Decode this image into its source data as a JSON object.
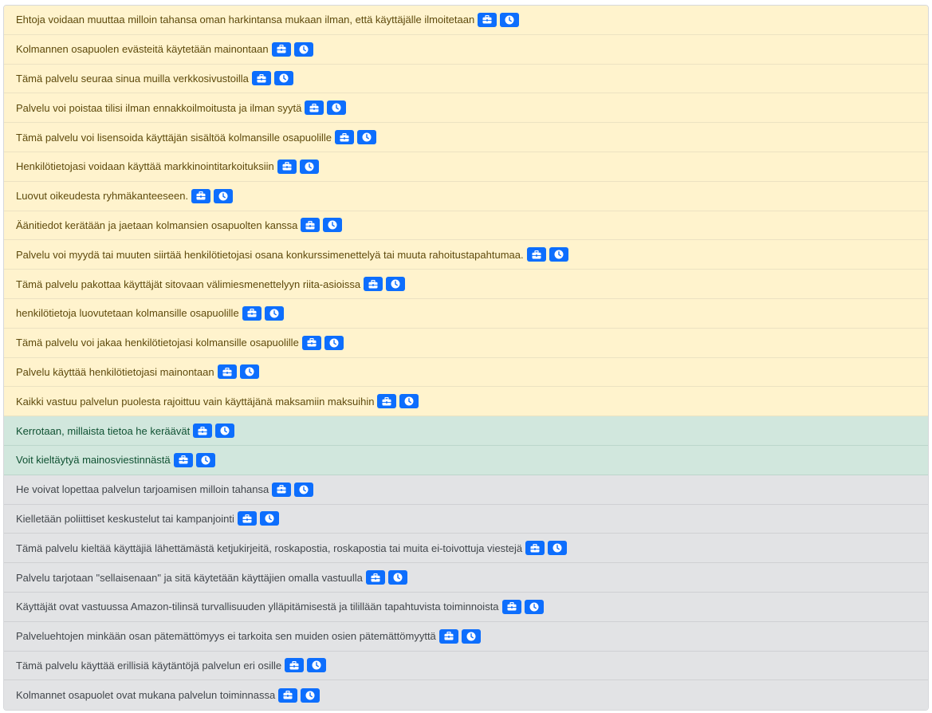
{
  "colors": {
    "bad_bg": "#fff3cd",
    "good_bg": "#d1e7dd",
    "neutral_bg": "#e2e3e5",
    "button_blue": "#0d6efd"
  },
  "icons": {
    "first_button": "briefcase-icon",
    "second_button": "clock-icon"
  },
  "items": [
    {
      "text": "Ehtoja voidaan muuttaa milloin tahansa oman harkintansa mukaan ilman, että käyttäjälle ilmoitetaan",
      "tone": "bad"
    },
    {
      "text": "Kolmannen osapuolen evästeitä käytetään mainontaan",
      "tone": "bad"
    },
    {
      "text": "Tämä palvelu seuraa sinua muilla verkkosivustoilla",
      "tone": "bad"
    },
    {
      "text": "Palvelu voi poistaa tilisi ilman ennakkoilmoitusta ja ilman syytä",
      "tone": "bad"
    },
    {
      "text": "Tämä palvelu voi lisensoida käyttäjän sisältöä kolmansille osapuolille",
      "tone": "bad"
    },
    {
      "text": "Henkilötietojasi voidaan käyttää markkinointitarkoituksiin",
      "tone": "bad"
    },
    {
      "text": "Luovut oikeudesta ryhmäkanteeseen.",
      "tone": "bad"
    },
    {
      "text": "Äänitiedot kerätään ja jaetaan kolmansien osapuolten kanssa",
      "tone": "bad"
    },
    {
      "text": "Palvelu voi myydä tai muuten siirtää henkilötietojasi osana konkurssimenettelyä tai muuta rahoitustapahtumaa.",
      "tone": "bad"
    },
    {
      "text": "Tämä palvelu pakottaa käyttäjät sitovaan välimiesmenettelyyn riita-asioissa",
      "tone": "bad"
    },
    {
      "text": "henkilötietoja luovutetaan kolmansille osapuolille",
      "tone": "bad"
    },
    {
      "text": "Tämä palvelu voi jakaa henkilötietojasi kolmansille osapuolille",
      "tone": "bad"
    },
    {
      "text": "Palvelu käyttää henkilötietojasi mainontaan",
      "tone": "bad"
    },
    {
      "text": "Kaikki vastuu palvelun puolesta rajoittuu vain käyttäjänä maksamiin maksuihin",
      "tone": "bad"
    },
    {
      "text": "Kerrotaan, millaista tietoa he keräävät",
      "tone": "good"
    },
    {
      "text": "Voit kieltäytyä mainosviestinnästä",
      "tone": "good"
    },
    {
      "text": "He voivat lopettaa palvelun tarjoamisen milloin tahansa",
      "tone": "neutral"
    },
    {
      "text": "Kielletään poliittiset keskustelut tai kampanjointi",
      "tone": "neutral"
    },
    {
      "text": "Tämä palvelu kieltää käyttäjiä lähettämästä ketjukirjeitä, roskapostia, roskapostia tai muita ei-toivottuja viestejä",
      "tone": "neutral"
    },
    {
      "text": "Palvelu tarjotaan \"sellaisenaan\" ja sitä käytetään käyttäjien omalla vastuulla",
      "tone": "neutral"
    },
    {
      "text": "Käyttäjät ovat vastuussa Amazon-tilinsä turvallisuuden ylläpitämisestä ja tilillään tapahtuvista toiminnoista",
      "tone": "neutral"
    },
    {
      "text": "Palveluehtojen minkään osan pätemättömyys ei tarkoita sen muiden osien pätemättömyyttä",
      "tone": "neutral"
    },
    {
      "text": "Tämä palvelu käyttää erillisiä käytäntöjä palvelun eri osille",
      "tone": "neutral"
    },
    {
      "text": "Kolmannet osapuolet ovat mukana palvelun toiminnassa",
      "tone": "neutral"
    }
  ]
}
